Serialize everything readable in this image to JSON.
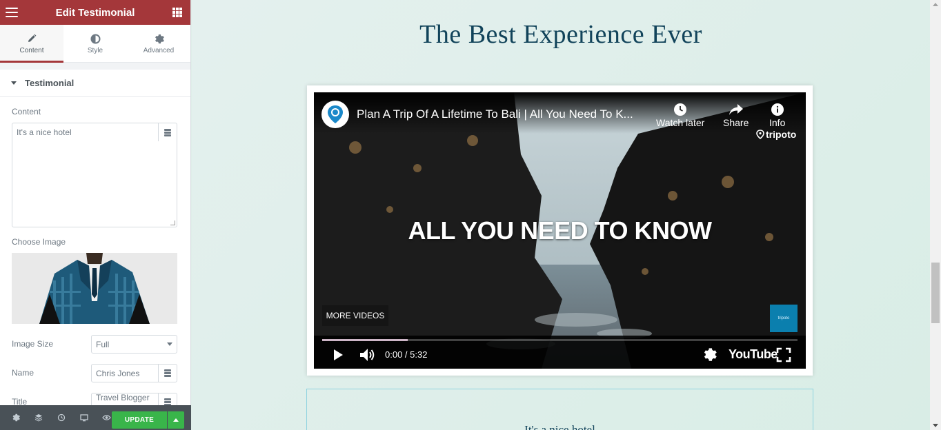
{
  "panel": {
    "header_title": "Edit Testimonial",
    "tabs": [
      {
        "label": "Content",
        "icon": "pencil-icon",
        "active": true
      },
      {
        "label": "Style",
        "icon": "half-circle-icon",
        "active": false
      },
      {
        "label": "Advanced",
        "icon": "gear-icon",
        "active": false
      }
    ],
    "section_title": "Testimonial",
    "content_label": "Content",
    "content_value": "It's a nice hotel",
    "image_label": "Choose Image",
    "image_size_label": "Image Size",
    "image_size_value": "Full",
    "name_label": "Name",
    "name_value": "Chris Jones",
    "title_label": "Title",
    "title_value": "Travel Blogger",
    "update_label": "UPDATE",
    "accent_color": "#a4373a",
    "update_color": "#39b54a"
  },
  "preview": {
    "headline": "The Best Experience Ever",
    "video": {
      "title": "Plan A Trip Of A Lifetime To Bali | All You Need To K...",
      "watch_later": "Watch later",
      "share": "Share",
      "info": "Info",
      "brand": "tripoto",
      "overlay_text": "ALL YOU NEED TO KNOW",
      "more_videos": "MORE VIDEOS",
      "watermark": "tripoto",
      "time": "0:00 / 5:32",
      "progress_fraction": 0.18,
      "yt_logo": "YouTube"
    },
    "testimonial_text": "It's a nice hotel",
    "headline_color": "#11435a"
  }
}
